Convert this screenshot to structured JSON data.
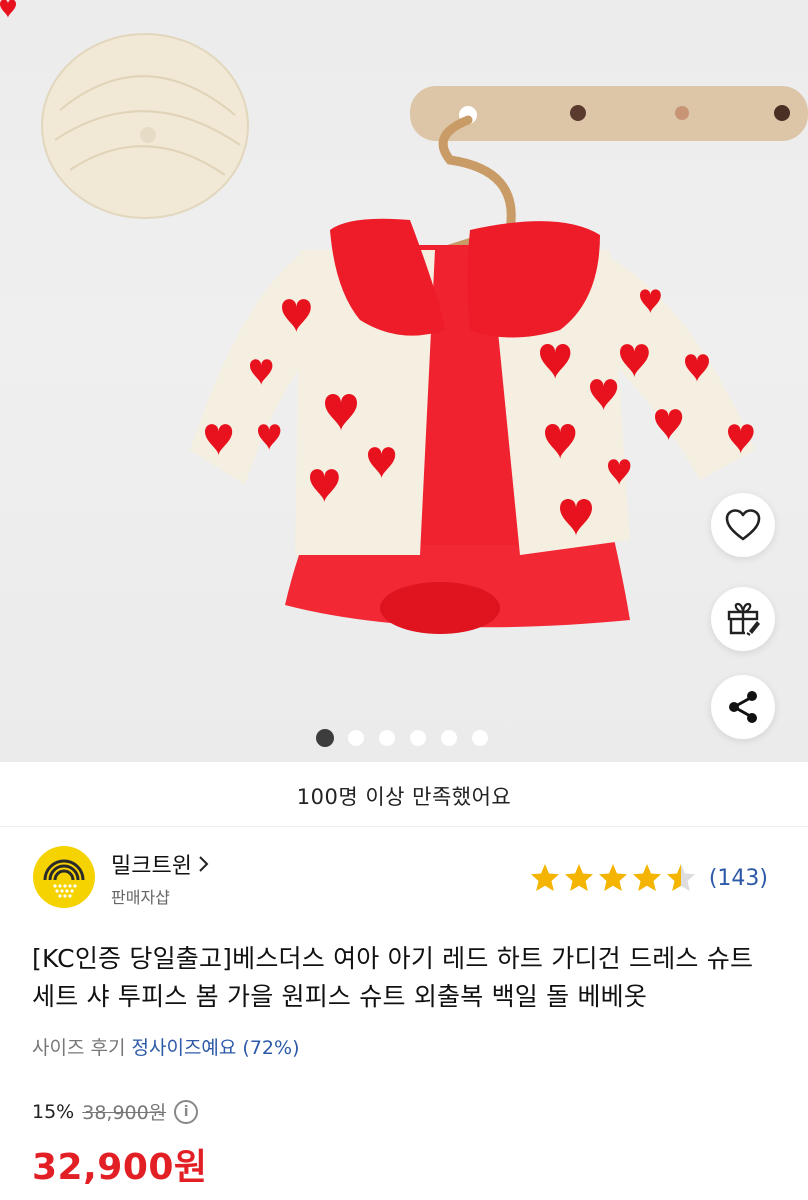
{
  "carousel": {
    "slide_count": 6,
    "active_index": 0
  },
  "actions": {
    "like_icon": "heart-outline-icon",
    "gift_icon": "gift-rocket-icon",
    "share_icon": "share-icon"
  },
  "satisfaction_text": "100명 이상 만족했어요",
  "seller": {
    "name": "밀크트윈",
    "subtitle": "판매자샵",
    "logo_color": "#f5d300"
  },
  "rating": {
    "stars": 4.5,
    "count": "(143)",
    "star_color": "#f5b400"
  },
  "product": {
    "title": "[KC인증 당일출고]베스더스 여아 아기 레드 하트 가디건 드레스 슈트 세트 샤 투피스 봄 가을 원피스 슈트 외출복 백일 돌 베베옷"
  },
  "size_review": {
    "label": "사이즈 후기",
    "value": "정사이즈예요 (72%)"
  },
  "price": {
    "discount": "15%",
    "original": "38,900원",
    "final": "32,900원",
    "final_color": "#e31f26"
  }
}
